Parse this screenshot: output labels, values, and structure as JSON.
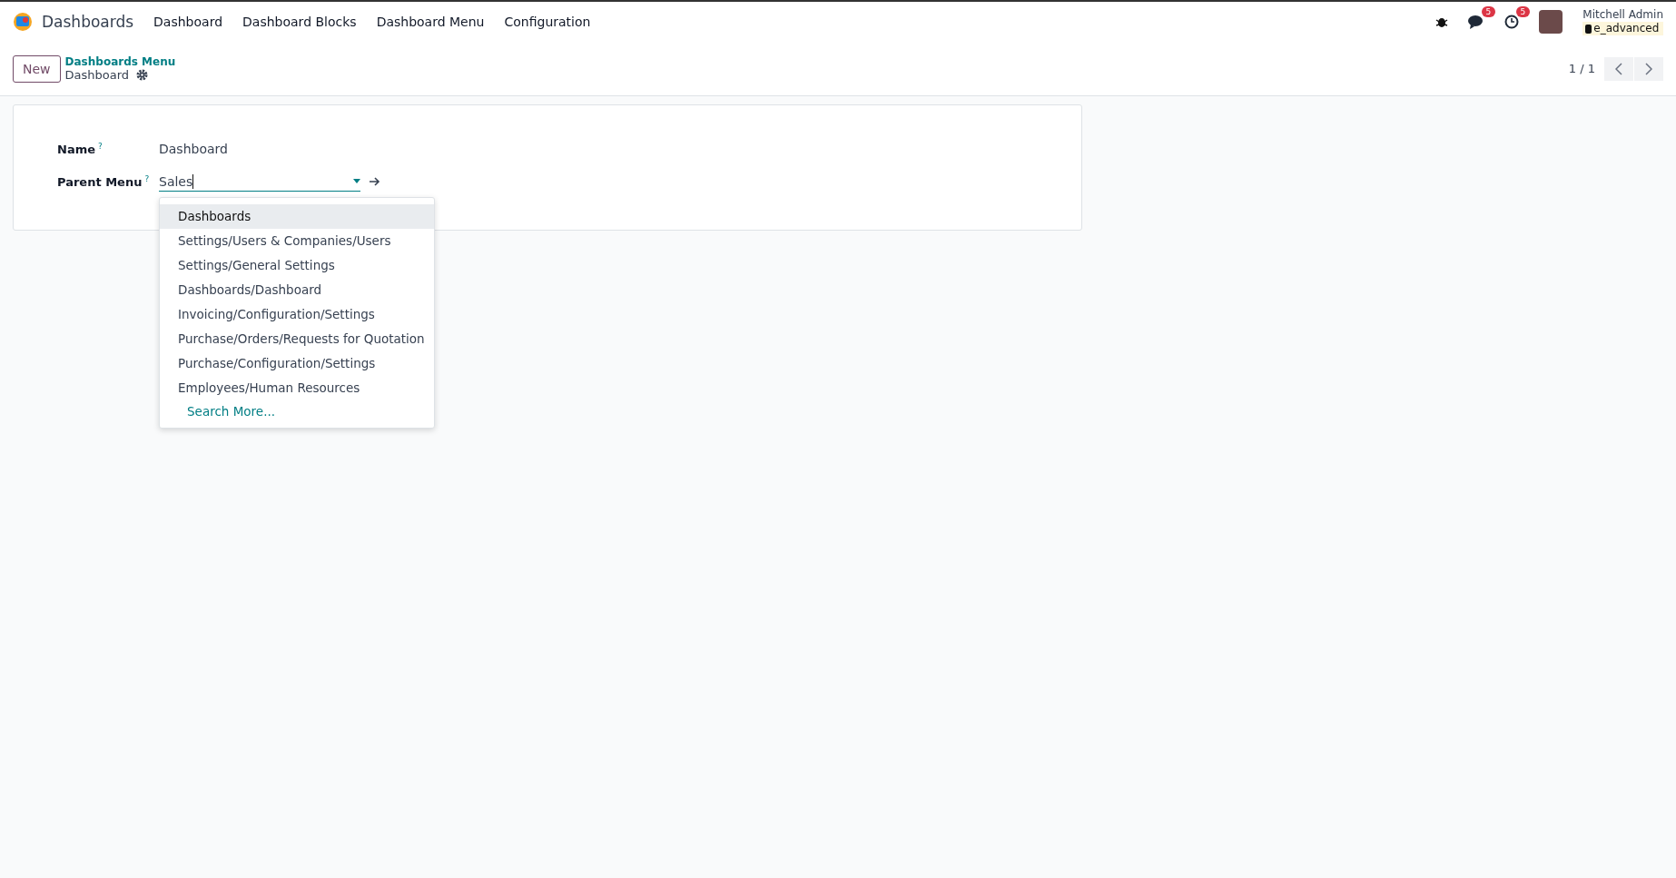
{
  "navbar": {
    "app_name": "Dashboards",
    "menu": [
      "Dashboard",
      "Dashboard Blocks",
      "Dashboard Menu",
      "Configuration"
    ],
    "chat_badge": "5",
    "activity_badge": "5",
    "user": {
      "name": "Mitchell Admin",
      "database": "e_advanced"
    }
  },
  "control_panel": {
    "new_button": "New",
    "breadcrumb": "Dashboards Menu",
    "record_title": "Dashboard",
    "pager": "1 / 1"
  },
  "form": {
    "fields": [
      {
        "label": "Name",
        "help": "?",
        "value": "Dashboard",
        "kind": "text"
      },
      {
        "label": "Parent Menu",
        "help": "?",
        "value": "Sales",
        "kind": "many2one"
      }
    ]
  },
  "dropdown": {
    "items": [
      {
        "label": "Dashboards",
        "selected": true
      },
      {
        "label": "Settings/Users & Companies/Users",
        "selected": false
      },
      {
        "label": "Settings/General Settings",
        "selected": false
      },
      {
        "label": "Dashboards/Dashboard",
        "selected": false
      },
      {
        "label": "Invoicing/Configuration/Settings",
        "selected": false
      },
      {
        "label": "Purchase/Orders/Requests for Quotation",
        "selected": false
      },
      {
        "label": "Purchase/Configuration/Settings",
        "selected": false
      },
      {
        "label": "Employees/Human Resources",
        "selected": false
      }
    ],
    "search_more": "Search More..."
  }
}
